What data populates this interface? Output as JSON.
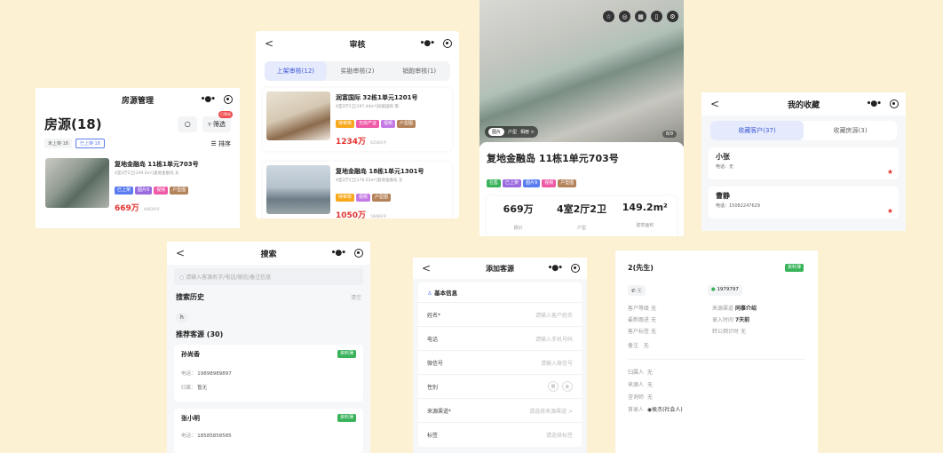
{
  "listing": {
    "nav_title": "房源管理",
    "heading": "房源(18)",
    "filter_label": "筛选",
    "filter_badge": "已筛选",
    "tab_off": "未上架·18",
    "tab_on": "已上架·18",
    "sort_label": "排序",
    "item": {
      "title": "复地金融岛 11栋1单元703号",
      "meta": "4室2厅2卫|149.2m²|复地金融岛 东",
      "tags": [
        "已上架",
        "图片9",
        "视频",
        "户型图"
      ],
      "price": "669万",
      "unit_price": "44839/平"
    }
  },
  "review": {
    "nav_title": "审核",
    "tabs": [
      "上架审核(12)",
      "实勘审核(2)",
      "销跑审核(1)"
    ],
    "items": [
      {
        "title": "润富国际 32栋1单元1201号",
        "meta": "4室2厅2卫|197.44m²|润富国际 南",
        "tags": [
          "待审核",
          "无房产证",
          "视频",
          "户型图"
        ],
        "price": "1234万",
        "unit_price": "62500/平"
      },
      {
        "title": "复地金融岛 18栋1单元1301号",
        "meta": "4室2厅2卫|179.53m²|复地金融岛 东",
        "tags": [
          "待审核",
          "视频",
          "户型图"
        ],
        "price": "1050万",
        "unit_price": "58489/平"
      }
    ]
  },
  "detail": {
    "photo_tabs": [
      "图片",
      "户型",
      "相册 >"
    ],
    "photo_counter": "8/9",
    "title": "复地金融岛 11栋1单元703号",
    "tags": [
      "在售",
      "已上架",
      "图片9",
      "视频",
      "户型图"
    ],
    "stats": [
      {
        "value": "669万",
        "label": "报价"
      },
      {
        "value": "4室2厅2卫",
        "label": "户型"
      },
      {
        "value": "149.2m²",
        "label": "建筑面积"
      }
    ]
  },
  "favorites": {
    "nav_title": "我的收藏",
    "tabs": [
      "收藏客户(37)",
      "收藏房源(3)"
    ],
    "items": [
      {
        "name": "小张",
        "phone": "电话：无"
      },
      {
        "name": "曹静",
        "phone": "电话：15082247629"
      }
    ]
  },
  "search": {
    "nav_title": "搜索",
    "placeholder": "请输入客源名字/电话/微信/备注信息",
    "history_title": "搜索历史",
    "clear_label": "清空",
    "history_chip": "h",
    "recommend_title": "推荐客源 (30)",
    "clients": [
      {
        "name": "孙尚香",
        "badge": "资料薄",
        "phone_label": "电话：",
        "phone": "19898989897",
        "owner_label": "归属：",
        "owner": "暂无"
      },
      {
        "name": "张小明",
        "badge": "资料薄",
        "phone_label": "电话：",
        "phone": "18585858585"
      }
    ]
  },
  "add_client": {
    "nav_title": "添加客源",
    "section": "基本信息",
    "fields": [
      {
        "label": "姓名*",
        "placeholder": "请输入客户姓名"
      },
      {
        "label": "电话",
        "placeholder": "请输入手机号码"
      },
      {
        "label": "微信号",
        "placeholder": "请输入微信号"
      },
      {
        "label": "性别",
        "placeholder": ""
      },
      {
        "label": "来源渠道*",
        "placeholder": "请选择来源渠道 >"
      },
      {
        "label": "标签",
        "placeholder": "请选择标签"
      }
    ],
    "gender_male": "男",
    "gender_female": "女"
  },
  "client_detail": {
    "name": "2(先生)",
    "badge": "资料薄",
    "phone": "无",
    "wechat": "1979797",
    "left": [
      {
        "label": "客户等级",
        "value": "无"
      },
      {
        "label": "最新跟进",
        "value": "无"
      },
      {
        "label": "客户标签",
        "value": "无"
      },
      {
        "label": "备注",
        "value": "无"
      }
    ],
    "right": [
      {
        "label": "来源渠道",
        "value": "同事介绍"
      },
      {
        "label": "录入时间",
        "value": "7天前"
      },
      {
        "label": "转公倒计时",
        "value": "无"
      }
    ],
    "people": [
      {
        "label": "归属人",
        "value": "无"
      },
      {
        "label": "来源人",
        "value": "无"
      },
      {
        "label": "咨询师",
        "value": "无"
      },
      {
        "label": "首录人",
        "value": "侯杰(社会人)"
      }
    ]
  },
  "colors": {
    "background": "#fdf1d4",
    "accent": "#3f5bd6",
    "price": "#e2332f",
    "green": "#38b35a"
  }
}
